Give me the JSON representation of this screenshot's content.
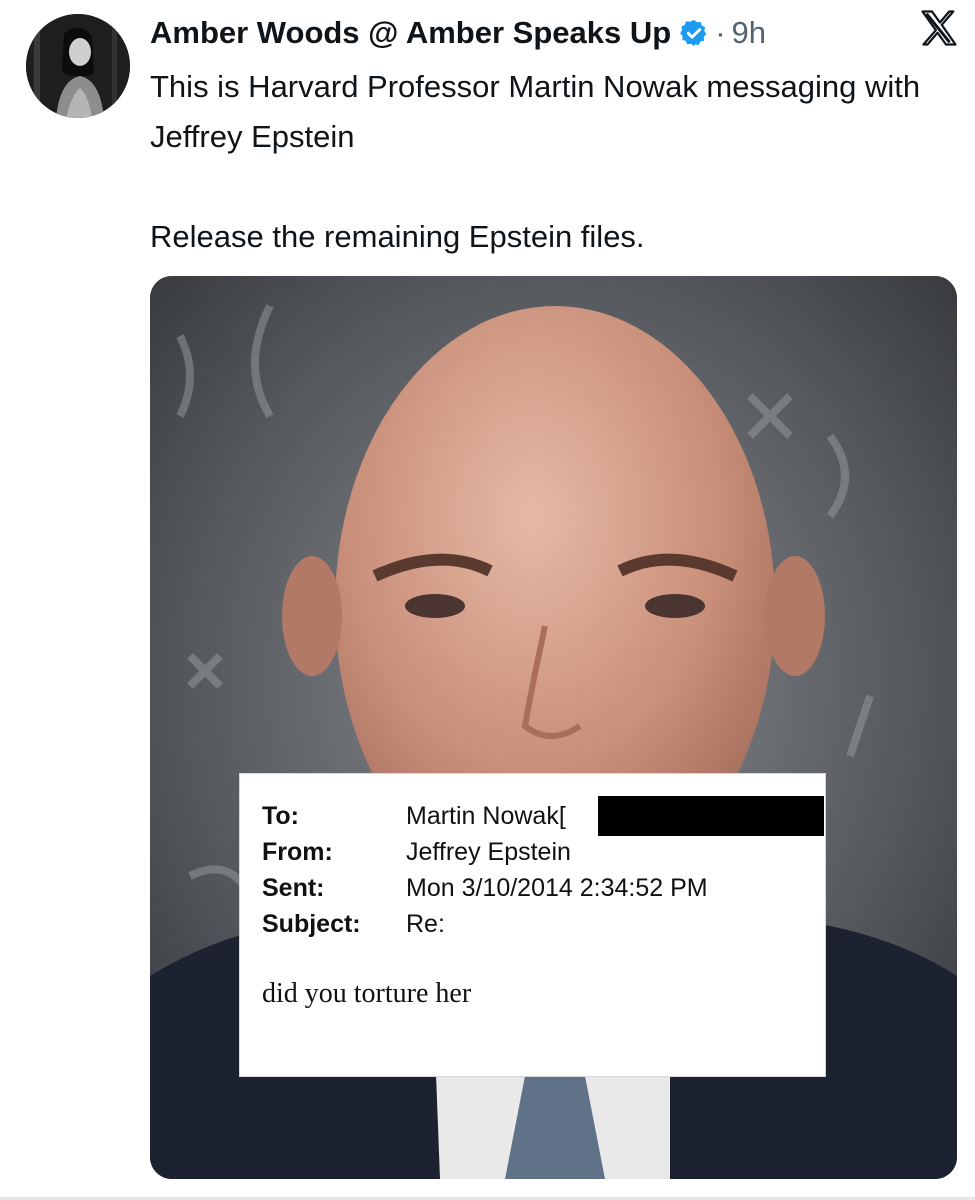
{
  "tweet": {
    "author_name": "Amber Woods @ Amber Speaks Up",
    "separator": "·",
    "time": "9h",
    "text_line1": "This is Harvard Professor Martin Nowak messaging with Jeffrey Epstein",
    "text_line2": "Release the remaining Epstein files.",
    "verified_icon": "verified-badge-icon",
    "platform_icon": "x-logo-icon",
    "colors": {
      "text": "#0f1419",
      "muted": "#536471",
      "verified": "#1d9bf0"
    }
  },
  "email_overlay": {
    "to_label": "To:",
    "to_value": "Martin Nowak[",
    "from_label": "From:",
    "from_value": "Jeffrey Epstein",
    "sent_label": "Sent:",
    "sent_value": "Mon 3/10/2014 2:34:52 PM",
    "subject_label": "Subject:",
    "subject_value": "Re:",
    "body": "did you torture her"
  }
}
